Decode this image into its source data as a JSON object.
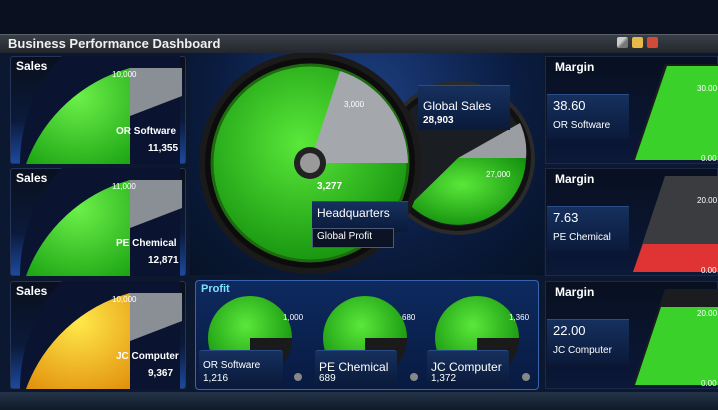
{
  "window": {
    "title": "Business Performance Dashboard"
  },
  "sales": [
    {
      "title": "Sales",
      "max_label": "10,000",
      "name": "OR Software",
      "value": "11,355"
    },
    {
      "title": "Sales",
      "max_label": "11,000",
      "name": "PE Chemical",
      "value": "12,871"
    },
    {
      "title": "Sales",
      "max_label": "10,000",
      "name": "JC Computer",
      "value": "9,367"
    }
  ],
  "center": {
    "big_gauge": {
      "tick": "3,000",
      "value": "3,277",
      "name": "Headquarters",
      "sub": "Global Profit"
    },
    "small_gauge": {
      "title": "Global Sales",
      "value": "28,903",
      "tick": "27,000"
    }
  },
  "profit": {
    "title": "Profit",
    "items": [
      {
        "tick": "1,000",
        "name": "OR Software",
        "value": "1,216"
      },
      {
        "tick": "680",
        "name": "PE Chemical",
        "value": "689"
      },
      {
        "tick": "1,360",
        "name": "JC Computer",
        "value": "1,372"
      }
    ]
  },
  "margin": [
    {
      "title": "Margin",
      "value": "38.60",
      "name": "OR Software",
      "top_tick": "30.00",
      "bottom_tick": "0.00",
      "color": "#39d12a"
    },
    {
      "title": "Margin",
      "value": "7.63",
      "name": "PE Chemical",
      "top_tick": "20.00",
      "bottom_tick": "0.00",
      "color": "#e03434"
    },
    {
      "title": "Margin",
      "value": "22.00",
      "name": "JC Computer",
      "top_tick": "20.00",
      "bottom_tick": "0.00",
      "color": "#39d12a"
    }
  ]
}
